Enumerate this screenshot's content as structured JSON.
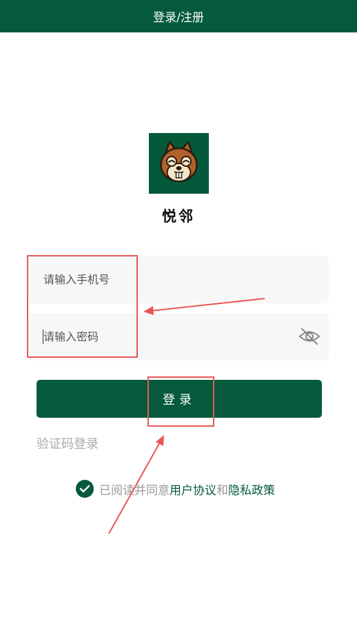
{
  "topbar": {
    "title": "登录/注册"
  },
  "app": {
    "name": "悦邻",
    "logo_icon": "squirrel-logo-icon"
  },
  "form": {
    "phone_placeholder": "请输入手机号",
    "password_placeholder": "请输入密码",
    "password_toggle_icon": "eye-off-icon"
  },
  "login_button": {
    "label": "登录"
  },
  "sms_login": {
    "label": "验证码登录"
  },
  "agreement": {
    "checked": true,
    "prefix": "已阅读并同意",
    "user_agreement": "用户协议",
    "conjunction": "和",
    "privacy_policy": "隐私政策"
  },
  "colors": {
    "brand": "#045a3a",
    "annotation": "#e85656",
    "field_background": "#f7f7f7"
  }
}
